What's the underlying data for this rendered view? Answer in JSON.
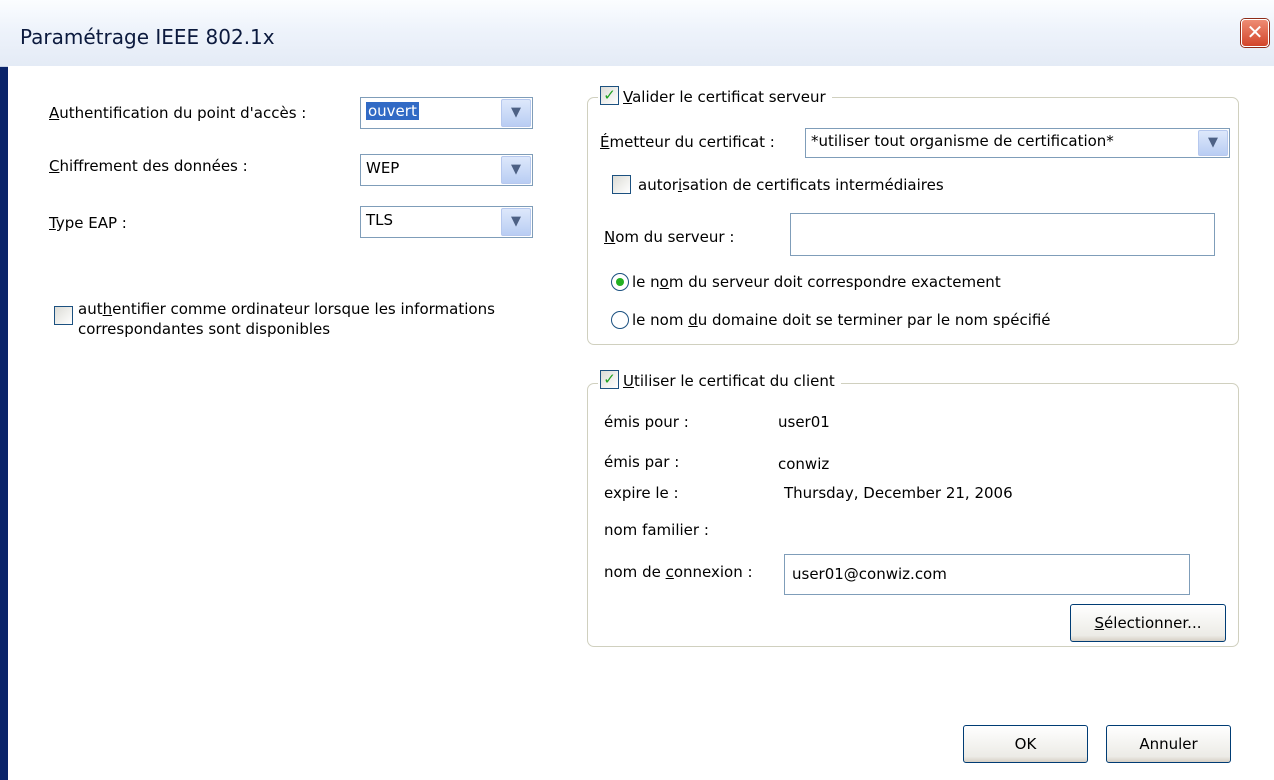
{
  "window": {
    "title": "Paramétrage IEEE 802.1x",
    "close_label": "✕"
  },
  "left": {
    "auth_label_ul": "A",
    "auth_label_rest": "uthentification du point d'accès :",
    "auth_value": "ouvert",
    "encrypt_label_ul": "C",
    "encrypt_label_rest": "hiffrement des données :",
    "encrypt_value": "WEP",
    "eap_label_ul": "T",
    "eap_label_rest": "ype EAP :",
    "eap_value": "TLS",
    "computer_auth_pre": "aut",
    "computer_auth_ul": "h",
    "computer_auth_line1": "entifier comme ordinateur lorsque les informations",
    "computer_auth_line2": "correspondantes sont disponibles",
    "computer_auth_checked": false
  },
  "server_cert": {
    "group_ul": "V",
    "group_rest": "alider le certificat serveur",
    "checked": true,
    "issuer_label_ul": "É",
    "issuer_label_rest": "metteur du certificat :",
    "issuer_value": "*utiliser tout organisme de certification*",
    "intermediate_pre": "autor",
    "intermediate_ul": "i",
    "intermediate_rest": "sation de certificats intermédiaires",
    "intermediate_checked": false,
    "server_name_label_ul": "N",
    "server_name_label_rest": "om du serveur :",
    "server_name_value": "",
    "match_exact_pre": "le n",
    "match_exact_ul": "o",
    "match_exact_rest": "m du serveur doit correspondre exactement",
    "match_exact_selected": true,
    "match_domain_pre": "le nom ",
    "match_domain_ul": "d",
    "match_domain_rest": "u domaine doit se terminer par le nom spécifié",
    "match_domain_selected": false
  },
  "client_cert": {
    "group_ul": "U",
    "group_rest": "tiliser le certificat du client",
    "checked": true,
    "issued_to_label": "émis pour :",
    "issued_to_value": "user01",
    "issued_by_label": "émis par :",
    "issued_by_value": "conwiz",
    "expires_label": "expire le :",
    "expires_value": "Thursday, December 21, 2006",
    "friendly_label": "nom familier :",
    "friendly_value": "",
    "login_label_pre": "nom de ",
    "login_label_ul": "c",
    "login_label_rest": "onnexion :",
    "login_value": "user01@conwiz.com",
    "select_ul": "S",
    "select_rest": "électionner..."
  },
  "buttons": {
    "ok": "OK",
    "cancel": "Annuler"
  },
  "icons": {
    "dropdown": "▼",
    "check": "✓"
  }
}
